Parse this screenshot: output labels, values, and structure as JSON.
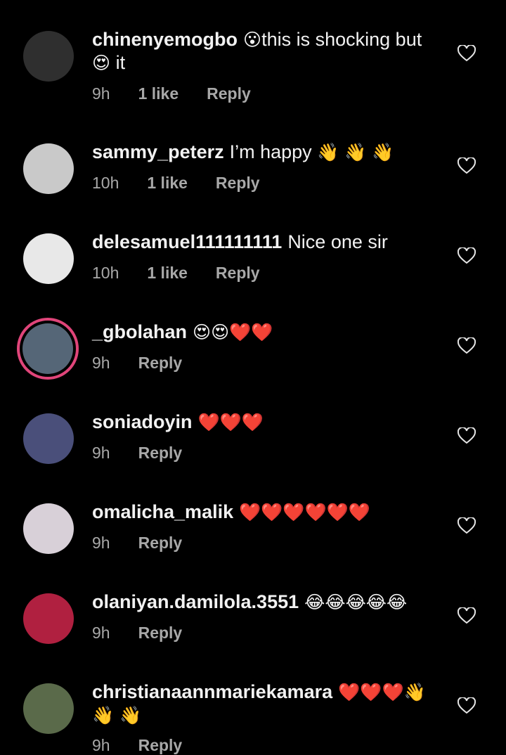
{
  "comments": [
    {
      "username": "chinenyemogbo",
      "pre_emoji": "😮",
      "text": "this is shocking but",
      "post_emoji": "😍",
      "text2": "it",
      "time": "9h",
      "likes": "1 like",
      "reply": "Reply"
    },
    {
      "username": "sammy_peterz",
      "text": "I’m happy",
      "emoji": "👋 👋 👋",
      "time": "10h",
      "likes": "1 like",
      "reply": "Reply"
    },
    {
      "username": "delesamuel111111111",
      "text": "Nice one sir",
      "time": "10h",
      "likes": "1 like",
      "reply": "Reply"
    },
    {
      "username": "_gbolahan",
      "emoji": "😍😍❤️❤️",
      "time": "9h",
      "reply": "Reply"
    },
    {
      "username": "soniadoyin",
      "emoji": "❤️❤️❤️",
      "time": "9h",
      "reply": "Reply"
    },
    {
      "username": "omalicha_malik",
      "emoji": "❤️❤️❤️❤️❤️❤️",
      "time": "9h",
      "reply": "Reply"
    },
    {
      "username": "olaniyan.damilola.3551",
      "emoji": "😂😂😂😂😂",
      "time": "9h",
      "reply": "Reply"
    },
    {
      "username": "christianaannmariekamara",
      "emoji": "❤️❤️❤️👋",
      "emoji2": "👋 👋",
      "time": "9h",
      "reply": "Reply"
    }
  ],
  "colors": {
    "background": "#000000",
    "text": "#f2f2f2",
    "meta": "#a8a8a8",
    "story_ring": "#e0457a"
  }
}
